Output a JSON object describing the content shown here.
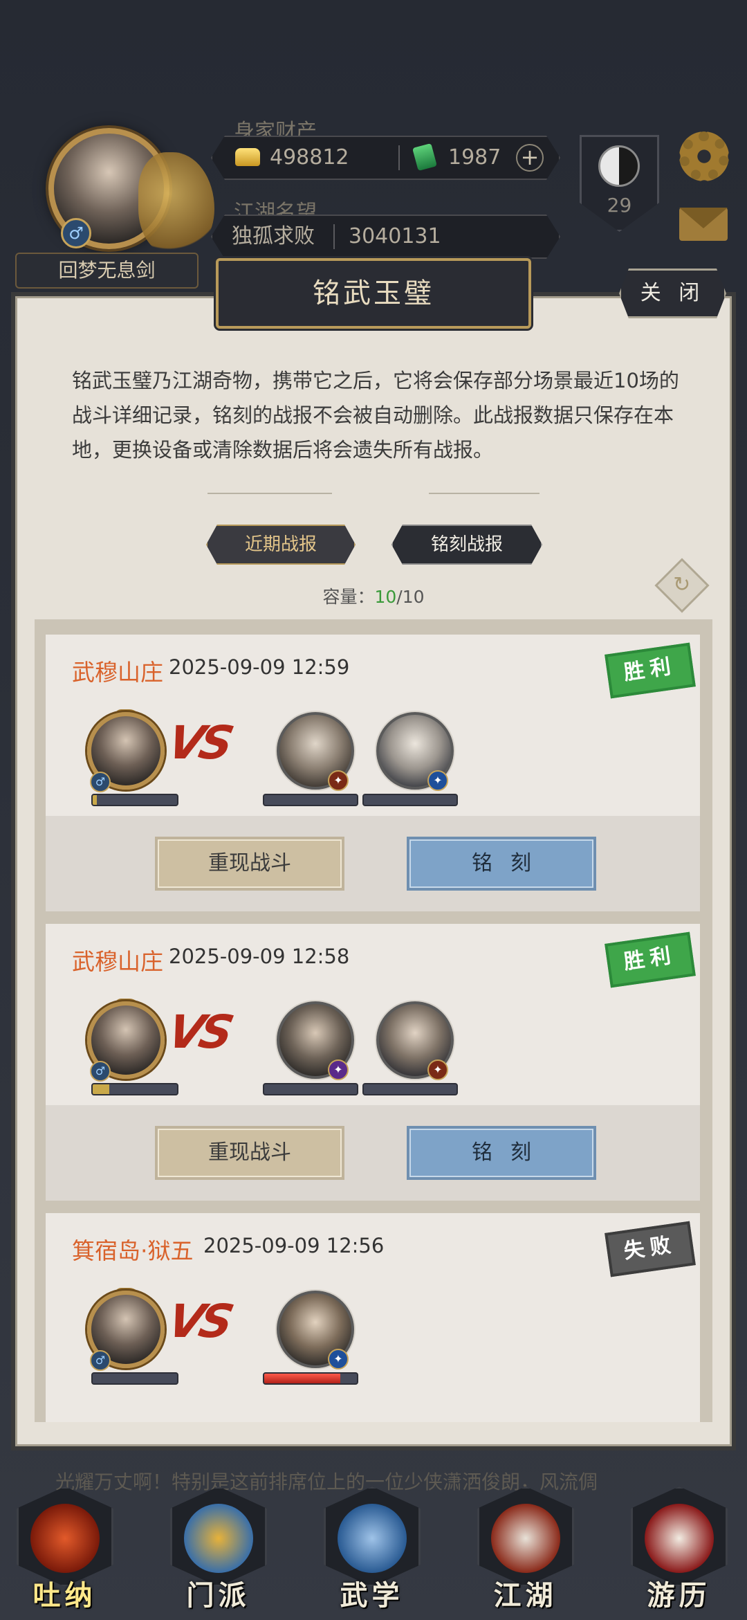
{
  "player": {
    "name": "回梦无息剑",
    "wealth_label": "身家财产",
    "gold": "498812",
    "jade": "1987",
    "reputation_label": "江湖名望",
    "title": "独孤求败",
    "reputation": "3040131",
    "level": "29"
  },
  "dialog": {
    "title": "铭武玉璧",
    "close_label": "关 闭",
    "intro": "铭武玉璧乃江湖奇物，携带它之后，它将会保存部分场景最近10场的战斗详细记录，铭刻的战报不会被自动删除。此战报数据只保存在本地，更换设备或清除数据后将会遗失所有战报。",
    "tabs": {
      "recent": "近期战报",
      "carved": "铭刻战报"
    },
    "capacity_label": "容量：",
    "capacity_current": "10",
    "capacity_total": "/10"
  },
  "battles": [
    {
      "location": "武穆山庄",
      "time": "2025-09-09 12:59",
      "result": "胜利",
      "vs": "VS",
      "replay": "重现战斗",
      "carve": "铭刻"
    },
    {
      "location": "武穆山庄",
      "time": "2025-09-09 12:58",
      "result": "胜利",
      "vs": "VS",
      "replay": "重现战斗",
      "carve": "铭刻"
    },
    {
      "location": "箕宿岛·狱五",
      "time": "2025-09-09 12:56",
      "result": "失败",
      "vs": "VS"
    }
  ],
  "health": {
    "battle1": {
      "self": 0.05,
      "enemy1": 0.0,
      "enemy2": 0.0
    },
    "battle2": {
      "self": 0.2,
      "enemy1": 0.0,
      "enemy2": 0.0
    },
    "battle3": {
      "self": 0.0,
      "enemy1": 0.82
    }
  },
  "scroll_text": "光耀万丈啊！特别是这前排席位上的一位少侠潇洒俊朗，风流倜",
  "nav": [
    "吐纳",
    "门派",
    "武学",
    "江湖",
    "游历"
  ],
  "colors": {
    "location": "#d9622b",
    "win": "#3fa64a",
    "lose": "#5a5a5a",
    "capacity_current": "#3a9a3a"
  }
}
